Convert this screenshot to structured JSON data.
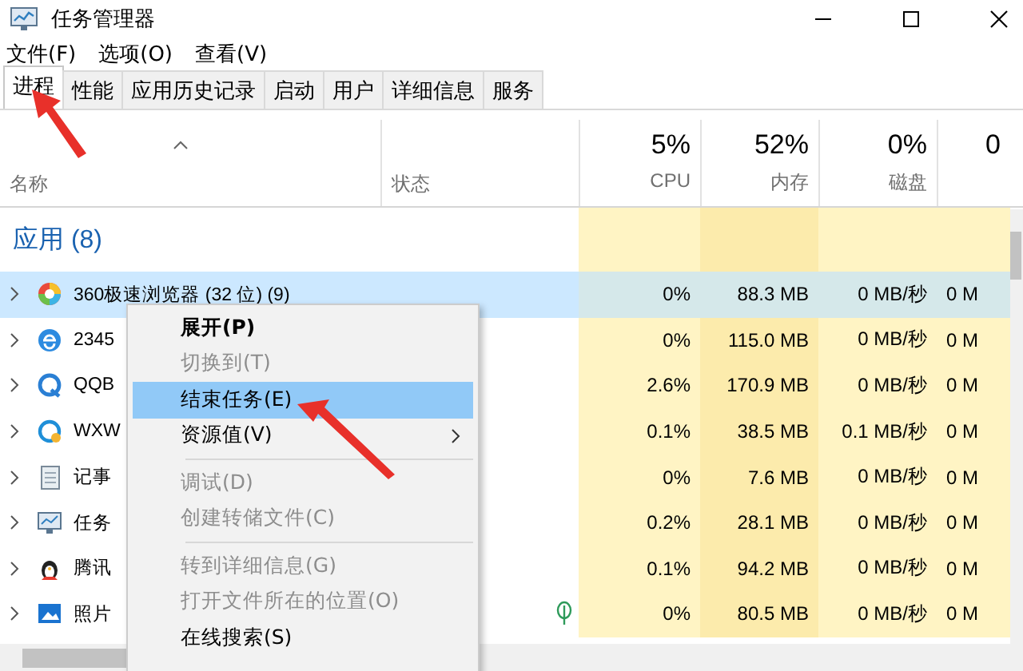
{
  "window": {
    "title": "任务管理器"
  },
  "menu_bar": [
    "文件(F)",
    "选项(O)",
    "查看(V)"
  ],
  "tabs": [
    {
      "label": "进程",
      "selected": true
    },
    {
      "label": "性能",
      "selected": false
    },
    {
      "label": "应用历史记录",
      "selected": false
    },
    {
      "label": "启动",
      "selected": false
    },
    {
      "label": "用户",
      "selected": false
    },
    {
      "label": "详细信息",
      "selected": false
    },
    {
      "label": "服务",
      "selected": false
    }
  ],
  "table": {
    "columns": [
      {
        "label": "名称"
      },
      {
        "label": "状态"
      },
      {
        "percent": "5%",
        "label": "CPU"
      },
      {
        "percent": "52%",
        "label": "内存"
      },
      {
        "percent": "0%",
        "label": "磁盘"
      },
      {
        "percent": "0"
      }
    ],
    "group": "应用 (8)",
    "rows": [
      {
        "name": "360极速浏览器 (32 位) (9)",
        "selected": true,
        "leaf": false,
        "cpu": "0%",
        "memory": "88.3 MB",
        "disk": "0 MB/秒",
        "network": "0 M"
      },
      {
        "name": "2345",
        "selected": false,
        "leaf": false,
        "cpu": "0%",
        "memory": "115.0 MB",
        "disk": "0 MB/秒",
        "network": "0 M"
      },
      {
        "name": "QQB",
        "selected": false,
        "leaf": false,
        "cpu": "2.6%",
        "memory": "170.9 MB",
        "disk": "0 MB/秒",
        "network": "0 M"
      },
      {
        "name": "WXW",
        "selected": false,
        "leaf": false,
        "cpu": "0.1%",
        "memory": "38.5 MB",
        "disk": "0.1 MB/秒",
        "network": "0 M"
      },
      {
        "name": "记事",
        "selected": false,
        "leaf": false,
        "cpu": "0%",
        "memory": "7.6 MB",
        "disk": "0 MB/秒",
        "network": "0 M"
      },
      {
        "name": "任务",
        "selected": false,
        "leaf": false,
        "cpu": "0.2%",
        "memory": "28.1 MB",
        "disk": "0 MB/秒",
        "network": "0 M"
      },
      {
        "name": "腾讯",
        "selected": false,
        "leaf": false,
        "cpu": "0.1%",
        "memory": "94.2 MB",
        "disk": "0 MB/秒",
        "network": "0 M"
      },
      {
        "name": "照片",
        "selected": false,
        "leaf": true,
        "cpu": "0%",
        "memory": "80.5 MB",
        "disk": "0 MB/秒",
        "network": "0 M"
      }
    ]
  },
  "context_menu": {
    "items": [
      {
        "kind": "item",
        "label": "展开(P)",
        "default": true,
        "disabled": false,
        "selected": false,
        "submenu": false
      },
      {
        "kind": "item",
        "label": "切换到(T)",
        "default": false,
        "disabled": true,
        "selected": false,
        "submenu": false
      },
      {
        "kind": "item",
        "label": "结束任务(E)",
        "default": false,
        "disabled": false,
        "selected": true,
        "submenu": false
      },
      {
        "kind": "item",
        "label": "资源值(V)",
        "default": false,
        "disabled": false,
        "selected": false,
        "submenu": true
      },
      {
        "kind": "separator"
      },
      {
        "kind": "item",
        "label": "调试(D)",
        "default": false,
        "disabled": true,
        "selected": false,
        "submenu": false
      },
      {
        "kind": "item",
        "label": "创建转储文件(C)",
        "default": false,
        "disabled": true,
        "selected": false,
        "submenu": false
      },
      {
        "kind": "separator"
      },
      {
        "kind": "item",
        "label": "转到详细信息(G)",
        "default": false,
        "disabled": true,
        "selected": false,
        "submenu": false
      },
      {
        "kind": "item",
        "label": "打开文件所在的位置(O)",
        "default": false,
        "disabled": true,
        "selected": false,
        "submenu": false
      },
      {
        "kind": "item",
        "label": "在线搜索(S)",
        "default": false,
        "disabled": false,
        "selected": false,
        "submenu": false
      }
    ]
  }
}
